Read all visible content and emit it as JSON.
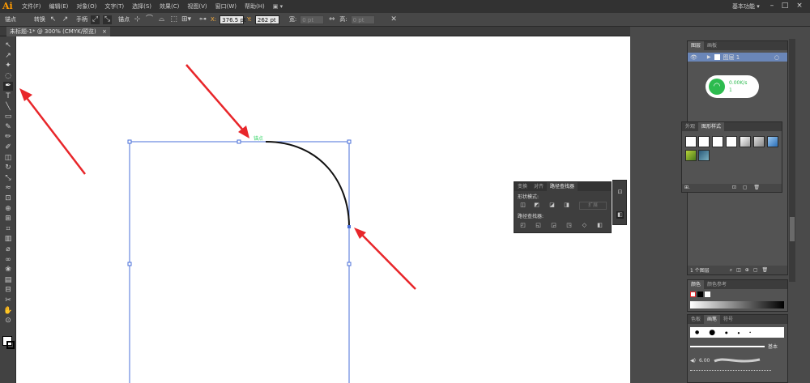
{
  "app": {
    "logo": "Ai",
    "workspace": "基本功能",
    "win_controls": [
      "–",
      "□",
      "×"
    ]
  },
  "menu": [
    "文件(F)",
    "编辑(E)",
    "对象(O)",
    "文字(T)",
    "选择(S)",
    "效果(C)",
    "视图(V)",
    "窗口(W)",
    "帮助(H)"
  ],
  "control_bar": {
    "mode_label": "锚点",
    "convert_label": "转换",
    "handles_label": "手柄",
    "anchor_label": "锚点",
    "x_label": "X:",
    "x_value": "376.5 pt",
    "y_label": "Y:",
    "y_value": "262 pt",
    "w_label": "宽:",
    "w_value": "0 pt",
    "h_label": "高:",
    "h_value": "0 pt"
  },
  "document": {
    "tab_title": "未标题-1* @ 300% (CMYK/预览)",
    "close": "×",
    "anchor_hint": "锚点"
  },
  "tools": [
    "selection-tool",
    "direct-selection-tool",
    "magic-wand-tool",
    "lasso-tool",
    "pen-tool",
    "type-tool",
    "line-tool",
    "rectangle-tool",
    "paintbrush-tool",
    "pencil-tool",
    "blob-brush-tool",
    "eraser-tool",
    "rotate-tool",
    "scale-tool",
    "width-tool",
    "free-transform-tool",
    "shape-builder-tool",
    "perspective-grid-tool",
    "mesh-tool",
    "gradient-tool",
    "eyedropper-tool",
    "blend-tool",
    "symbol-sprayer-tool",
    "column-graph-tool",
    "artboard-tool",
    "slice-tool",
    "hand-tool",
    "zoom-tool"
  ],
  "tool_glyphs": [
    "↖",
    "↗",
    "✦",
    "◌",
    "✒",
    "T",
    "╲",
    "▭",
    "✎",
    "✏",
    "✐",
    "◫",
    "↻",
    "⤡",
    "≈",
    "⊡",
    "⊕",
    "⊞",
    "⌗",
    "▥",
    "⌀",
    "∞",
    "❀",
    "▤",
    "⊟",
    "✂",
    "✋",
    "⊙"
  ],
  "layers_panel": {
    "tabs": [
      "图层",
      "画板"
    ],
    "layer_name": "图层 1",
    "footer": "1 个图层"
  },
  "network_widget": {
    "speed": "0.00K/s",
    "count": "1"
  },
  "graphic_styles_panel": {
    "tabs": [
      "外观",
      "图形样式"
    ]
  },
  "pathfinder_panel": {
    "tabs": [
      "变换",
      "对齐",
      "路径查找器"
    ],
    "shape_modes_label": "形状模式:",
    "expand_button": "扩展",
    "pathfinders_label": "路径查找器:"
  },
  "color_panel": {
    "tabs": [
      "颜色",
      "颜色参考"
    ]
  },
  "brushes_panel": {
    "tabs": [
      "色板",
      "画笔",
      "符号"
    ],
    "basic_label": "基本",
    "stroke_value": "6.00"
  },
  "colors": {
    "accent_orange": "#ff9a00",
    "path_blue": "#4a6fd8",
    "arrow_red": "#e8262a",
    "widget_green": "#2dbb4f"
  }
}
